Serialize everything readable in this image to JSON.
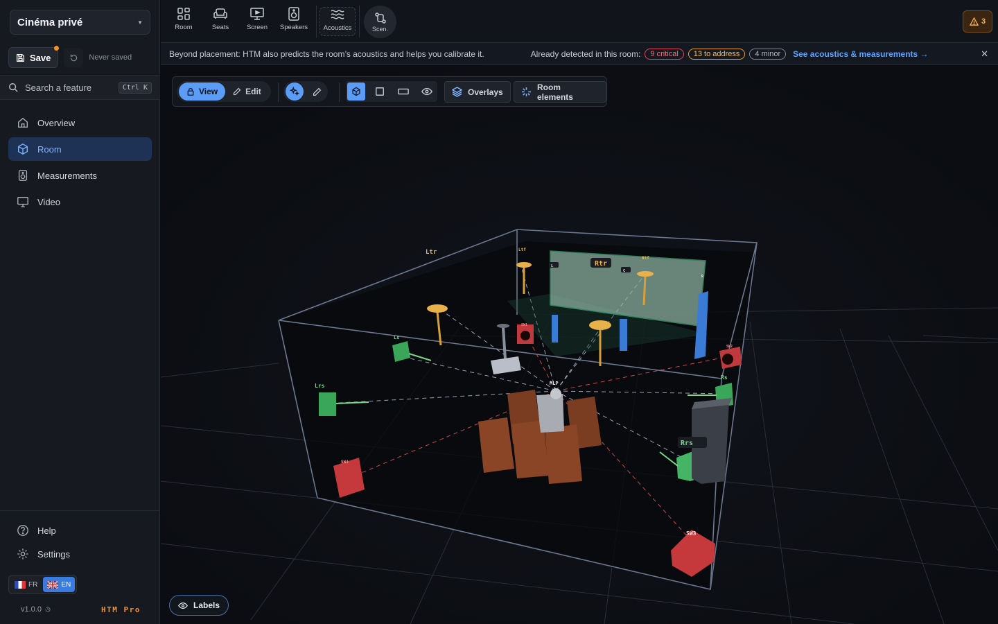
{
  "project": {
    "name": "Cinéma privé"
  },
  "save": {
    "label": "Save",
    "status": "Never saved"
  },
  "search": {
    "placeholder": "Search a feature",
    "shortcut": "Ctrl K"
  },
  "nav": {
    "items": [
      {
        "label": "Overview"
      },
      {
        "label": "Room"
      },
      {
        "label": "Measurements"
      },
      {
        "label": "Video"
      }
    ]
  },
  "bottom": {
    "help": "Help",
    "settings": "Settings"
  },
  "lang": {
    "fr": "FR",
    "en": "EN",
    "selected": "EN"
  },
  "footer": {
    "version": "v1.0.0",
    "edition": "HTM Pro"
  },
  "topbar": {
    "tools": [
      "Room",
      "Seats",
      "Screen",
      "Speakers",
      "Acoustics"
    ],
    "scenes": "Scen.",
    "warnings": "3"
  },
  "info": {
    "message": "Beyond placement: HTM also predicts the room’s acoustics and helps you calibrate it.",
    "detected": "Already detected in this room:",
    "critical": "9 critical",
    "address": "13 to address",
    "minor": "4 minor",
    "link": "See acoustics & measurements →"
  },
  "toolbar": {
    "view": "View",
    "edit": "Edit",
    "overlays": "Overlays",
    "room_elements": "Room elements"
  },
  "scene": {
    "labels": {
      "ltr": "Ltr",
      "ltf": "Ltf",
      "rtr": "Rtr",
      "rtf": "Rtf",
      "l": "L",
      "c": "C",
      "r": "R",
      "ls": "Ls",
      "lrs": "Lrs",
      "rs": "Rs",
      "rrs": "Rrs",
      "mlp": "MLP",
      "sw1": "SW1",
      "sw2": "SW2",
      "sw3": "SW3",
      "sw4": "SW4"
    },
    "labels_button": "Labels"
  },
  "colors": {
    "accent": "#5a9cf6",
    "brand_orange": "#f0922b",
    "critical": "#e0494d",
    "warning": "#e6a12a"
  }
}
